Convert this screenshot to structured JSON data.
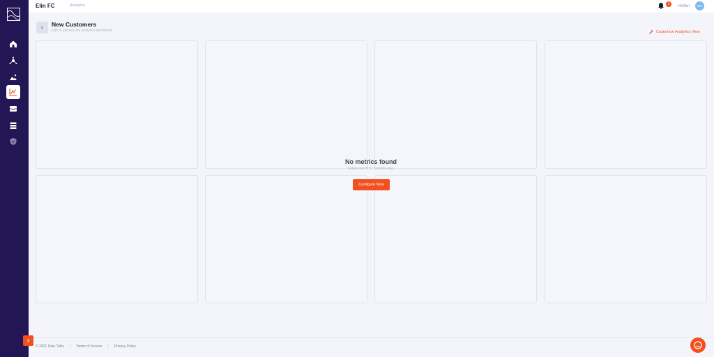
{
  "header": {
    "brand": "Elin FC",
    "breadcrumb": "Analytics",
    "notification_count": "1",
    "greeting": "Hi Elin!",
    "avatar_initials": "EM"
  },
  "sidebar": {
    "items": [
      {
        "name": "home",
        "icon": "home-icon"
      },
      {
        "name": "network",
        "icon": "network-icon"
      },
      {
        "name": "landscape",
        "icon": "landscape-icon"
      },
      {
        "name": "analytics",
        "icon": "chart-icon",
        "active": true
      },
      {
        "name": "inbox",
        "icon": "inbox-icon"
      },
      {
        "name": "database",
        "icon": "database-icon"
      },
      {
        "name": "security",
        "icon": "shield-icon"
      }
    ]
  },
  "page": {
    "title": "New Customers",
    "subtitle": "Edit or preview the analytics dashboard",
    "customize_label": "Customize Analytics View"
  },
  "empty_state": {
    "title": "No metrics found",
    "subtitle": "Setup your first Dashlets now.",
    "button_label": "Configure Now"
  },
  "footer": {
    "copyright": "© 2021 Data Talks",
    "terms": "Terms of Service",
    "privacy": "Privacy Policy"
  },
  "colors": {
    "sidebar": "#231654",
    "accent": "#f1501f",
    "background": "#f3f5fa"
  }
}
